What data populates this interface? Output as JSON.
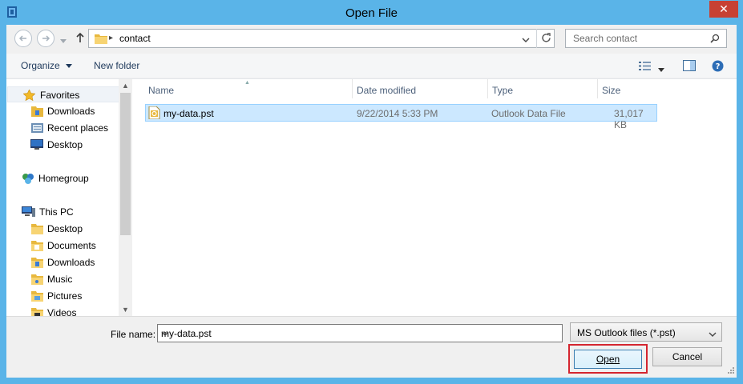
{
  "window": {
    "title": "Open File",
    "close_symbol": "✕"
  },
  "address_bar": {
    "path": [
      "contact"
    ]
  },
  "search": {
    "placeholder": "Search contact"
  },
  "toolbar": {
    "organize_label": "Organize",
    "new_folder_label": "New folder"
  },
  "sidebar": {
    "items": [
      {
        "label": "Favorites",
        "icon": "star-icon"
      },
      {
        "label": "Downloads",
        "icon": "downloads-folder-icon"
      },
      {
        "label": "Recent places",
        "icon": "recent-places-icon"
      },
      {
        "label": "Desktop",
        "icon": "desktop-icon"
      },
      {
        "label": "Homegroup",
        "icon": "homegroup-icon"
      },
      {
        "label": "This PC",
        "icon": "computer-icon"
      },
      {
        "label": "Desktop",
        "icon": "folder-icon"
      },
      {
        "label": "Documents",
        "icon": "folder-icon"
      },
      {
        "label": "Downloads",
        "icon": "folder-icon"
      },
      {
        "label": "Music",
        "icon": "folder-icon"
      },
      {
        "label": "Pictures",
        "icon": "folder-icon"
      },
      {
        "label": "Videos",
        "icon": "folder-icon"
      }
    ]
  },
  "file_list": {
    "columns": [
      "Name",
      "Date modified",
      "Type",
      "Size"
    ],
    "rows": [
      {
        "name": "my-data.pst",
        "date_modified": "9/22/2014 5:33 PM",
        "type": "Outlook Data File",
        "size": "31,017 KB"
      }
    ]
  },
  "bottom": {
    "file_name_label": "File name:",
    "file_name_value": "my-data.pst",
    "file_type_value": "MS Outlook files (*.pst)",
    "open_label": "Open",
    "cancel_label": "Cancel"
  },
  "colors": {
    "title_bar": "#5ab4e8",
    "close_button": "#c74133",
    "selection": "#cce8ff",
    "highlight_box": "#d4252f"
  }
}
